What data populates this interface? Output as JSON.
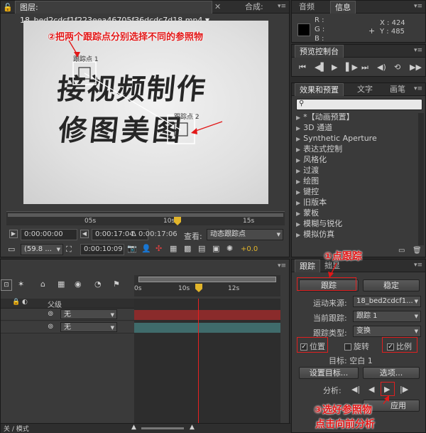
{
  "viewer": {
    "tab_title": "图层: 18_bed2cdcf1f223eea46705f36dcdc7d18.mp4",
    "tab_comp": "合成:",
    "tracker1_label": "跟踪点 1",
    "tracker2_label": "跟踪点 2",
    "video_text_line1": "接视频制作",
    "video_text_line2": "修图美图",
    "ruler_marks": [
      "05s",
      "10s",
      "15s"
    ],
    "time_start": "0:00:00:00",
    "time_end": "0:00:17:04",
    "time_duration": "Δ 0:00:17:06",
    "view_label": "查看:",
    "view_value": "动态跟踪点",
    "zoom_value": "(59.8 ...",
    "current_time": "0:00:10:09",
    "exposure_value": "+0.0"
  },
  "info_panel": {
    "tabs": [
      "音频",
      "信息"
    ],
    "r": "R :",
    "g": "G :",
    "b": "B :",
    "x": "X : 424",
    "y": "Y : 485"
  },
  "preview_panel": {
    "title": "预览控制台"
  },
  "effects_panel": {
    "tabs": [
      "效果和预置",
      "文字",
      "画笔"
    ],
    "search_placeholder": "",
    "items": [
      "*【动画预置】",
      "3D 通道",
      "Synthetic Aperture",
      "表达式控制",
      "风格化",
      "过渡",
      "绘图",
      "键控",
      "旧版本",
      "蒙板",
      "模糊与锐化",
      "模拟仿真"
    ]
  },
  "timeline": {
    "ruler_marks": [
      "0s",
      "10s",
      "12s"
    ],
    "parent_header": "父级",
    "rows": [
      {
        "parent": "无"
      },
      {
        "parent": "无"
      }
    ],
    "status_label": "关 / 模式"
  },
  "tracker_panel": {
    "tabs": [
      "跟踪",
      "拙显"
    ],
    "track_button": "跟踪",
    "stabilize_button": "稳定",
    "source_label": "运动来源:",
    "source_value": "18_bed2cdcf1...",
    "current_track_label": "当前跟踪:",
    "current_track_value": "跟踪 1",
    "track_type_label": "跟踪类型:",
    "track_type_value": "变换",
    "position_label": "位置",
    "rotation_label": "旋转",
    "scale_label": "比例",
    "target_label": "目标: 空白 1",
    "set_target_button": "设置目标...",
    "options_button": "选项...",
    "analyze_label": "分析:",
    "apply_partial": "应用"
  },
  "annotations": {
    "step1": "①点跟踪",
    "step2": "②把两个跟踪点分别选择不同的参照物",
    "step3_line1": "③选好参照物",
    "step3_line2": "点击向前分析"
  },
  "colors": {
    "annotation_red": "#e21818",
    "timeline_bar_red": "#8a2b2b",
    "timeline_bar_teal": "#3f6b6b",
    "playhead": "#e82020"
  }
}
